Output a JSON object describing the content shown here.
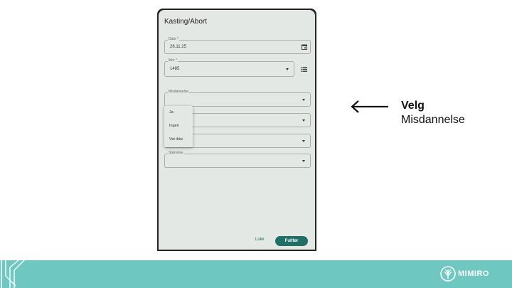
{
  "dialog": {
    "title": "Kasting/Abort",
    "fields": {
      "dato": {
        "label": "Dato *",
        "value": "26.11.25"
      },
      "mor": {
        "label": "Mor *",
        "value": "1485"
      },
      "misdannelse": {
        "label": "Misdannelse",
        "value": ""
      },
      "storrelse": {
        "label": "Størrelse",
        "value": ""
      }
    },
    "menu": {
      "items": [
        "Ja",
        "Ingen",
        "Vet ikke"
      ]
    },
    "buttons": {
      "close": "Lukk",
      "submit": "Fullfør"
    }
  },
  "annotation": {
    "title": "Velg",
    "subtitle": "Misdannelse"
  },
  "footer": {
    "brand": "MIMIRO"
  },
  "colors": {
    "accent": "#1f6e68",
    "footer": "#6ec7c0",
    "screen_bg": "#e3e8e5"
  }
}
